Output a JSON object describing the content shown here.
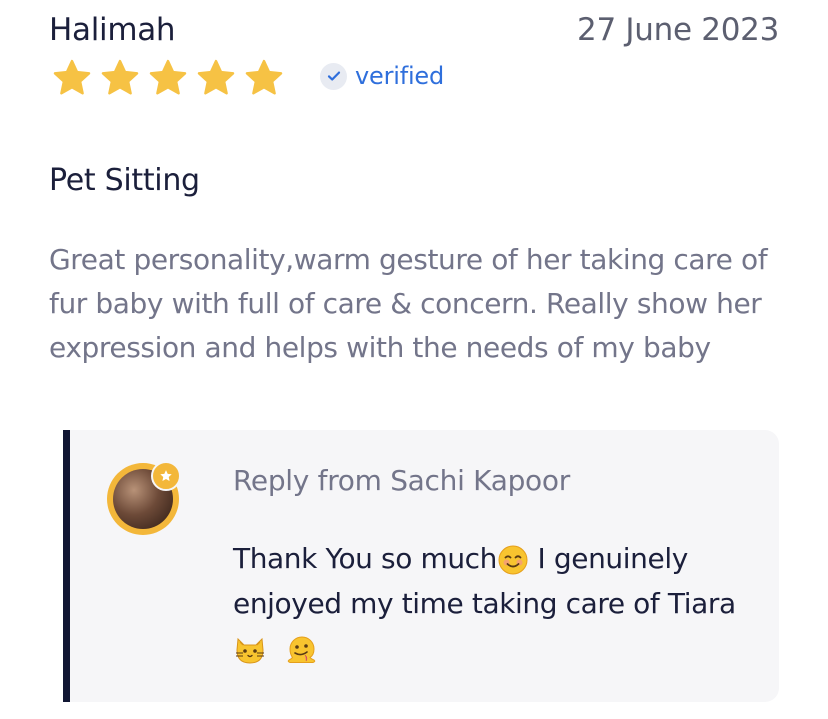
{
  "review": {
    "reviewer_name": "Halimah",
    "date": "27 June 2023",
    "rating": 5,
    "rating_max": 5,
    "verified_label": "verified",
    "service_title": "Pet Sitting",
    "text": "Great personality,warm gesture of her taking care of fur baby with full of care & concern. Really show her expression and helps with the needs of my baby"
  },
  "reply": {
    "header": "Reply from Sachi Kapoor",
    "text_part1": "Thank You so much",
    "text_part2": " I genuinely enjoyed my time taking care of Tiara ",
    "emojis": [
      "smiling-face-emoji",
      "cat-face-emoji",
      "melting-face-emoji"
    ]
  },
  "colors": {
    "star": "#f6c244",
    "verified_blue": "#2f6fdc",
    "reply_border": "#111633",
    "reply_bg": "#f6f6f8",
    "avatar_ring": "#f3b73a"
  }
}
